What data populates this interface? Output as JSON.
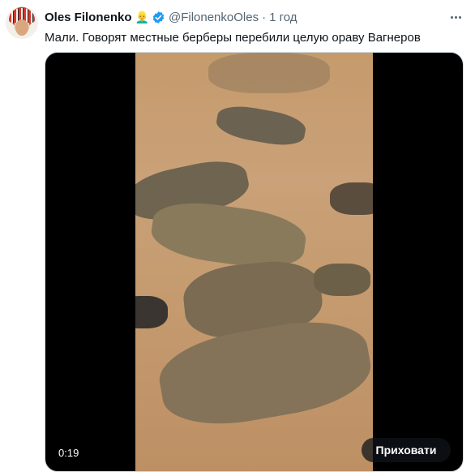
{
  "tweet": {
    "author_name": "Oles Filonenko",
    "author_emoji": "👱‍♂️",
    "verified_icon": "verified-badge-icon",
    "handle": "@FilonenkoOles",
    "separator": "·",
    "time": "1 год",
    "more_icon": "more-options-icon",
    "text": "Мали. Говорят местные берберы перебили целую ораву Вагнеров"
  },
  "media": {
    "timestamp": "0:19",
    "hide_button_label": "Приховати"
  },
  "colors": {
    "primary_text": "#0f1419",
    "secondary_text": "#536471",
    "verified_blue": "#1d9bf0",
    "media_background": "#000000",
    "sand": "#c59b6c"
  }
}
